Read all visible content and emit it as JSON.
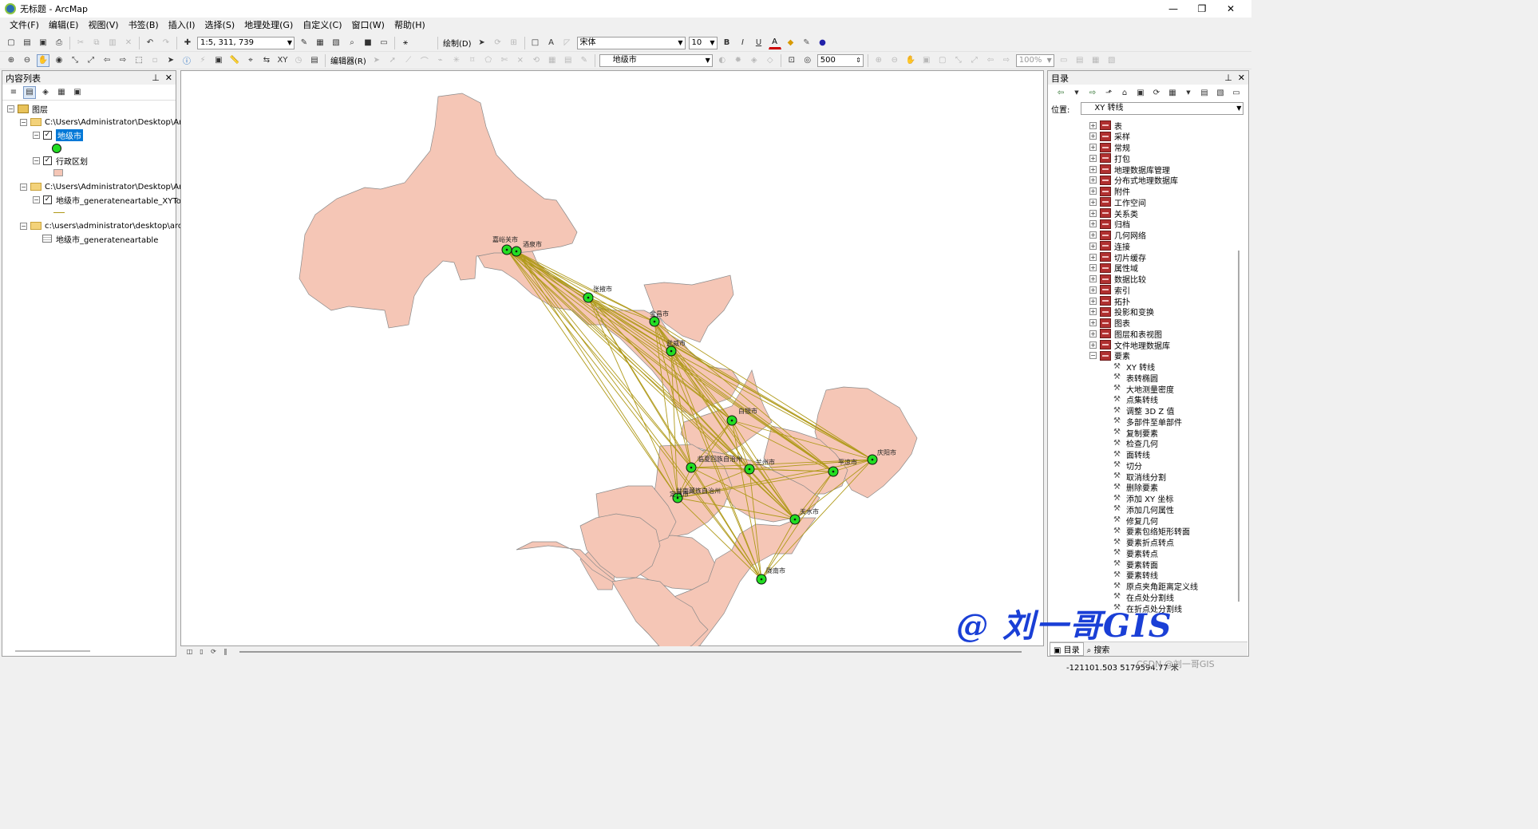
{
  "window": {
    "title": "无标题 - ArcMap",
    "min": "—",
    "max": "❐",
    "close": "✕"
  },
  "menu": [
    "文件(F)",
    "编辑(E)",
    "视图(V)",
    "书签(B)",
    "插入(I)",
    "选择(S)",
    "地理处理(G)",
    "自定义(C)",
    "窗口(W)",
    "帮助(H)"
  ],
  "toolbar1": {
    "scale": "1:5, 311, 739",
    "draw_label": "绘制(D)",
    "font": "宋体",
    "font_size": "10",
    "bold": "B",
    "italic": "I",
    "underline": "U",
    "font_color": "A"
  },
  "toolbar2": {
    "editor_label": "编辑器(R)",
    "layer_select": "地级市",
    "buffer_value": "500",
    "zoom_percent": "100%"
  },
  "toc": {
    "title": "内容列表",
    "pin": "ᵩ",
    "close": "✕",
    "root": "图层",
    "groups": [
      {
        "path": "C:\\Users\\Administrator\\Desktop\\Ar",
        "layers": [
          {
            "name": "地级市",
            "selected": true
          },
          {
            "name": "行政区划"
          }
        ]
      },
      {
        "path": "C:\\Users\\Administrator\\Desktop\\Ar",
        "layers": [
          {
            "name": "地级市_generateneartable_XYTo"
          }
        ]
      },
      {
        "path": "c:\\users\\administrator\\desktop\\arc",
        "layers": [
          {
            "name": "地级市_generateneartable"
          }
        ]
      }
    ]
  },
  "catalog": {
    "title": "目录",
    "location_label": "位置:",
    "location_value": "XY 转线",
    "toolsets": [
      "表",
      "采样",
      "常规",
      "打包",
      "地理数据库管理",
      "分布式地理数据库",
      "附件",
      "工作空间",
      "关系类",
      "归档",
      "几何网络",
      "连接",
      "切片缓存",
      "属性域",
      "数据比较",
      "索引",
      "拓扑",
      "投影和变换",
      "图表",
      "图层和表视图",
      "文件地理数据库",
      "要素"
    ],
    "tools": [
      "XY 转线",
      "表转椭圆",
      "大地测量密度",
      "点集转线",
      "调整 3D Z 值",
      "多部件至单部件",
      "复制要素",
      "检查几何",
      "面转线",
      "切分",
      "取消线分割",
      "删除要素",
      "添加 XY 坐标",
      "添加几何属性",
      "修复几何",
      "要素包络矩形转面",
      "要素折点转点",
      "要素转点",
      "要素转面",
      "要素转线",
      "原点夹角距离定义线",
      "在点处分割线",
      "在折点处分割线"
    ],
    "tabs": [
      "目录",
      "搜索"
    ]
  },
  "map": {
    "cities": [
      {
        "name": "嘉峪关市"
      },
      {
        "name": "酒泉市"
      },
      {
        "name": "张掖市"
      },
      {
        "name": "金昌市"
      },
      {
        "name": "武威市"
      },
      {
        "name": "白银市"
      },
      {
        "name": "临夏回族自治州"
      },
      {
        "name": "兰州市"
      },
      {
        "name": "定西市"
      },
      {
        "name": "甘南藏族自治州"
      },
      {
        "name": "平凉市"
      },
      {
        "name": "庆阳市"
      },
      {
        "name": "天水市"
      },
      {
        "name": "陇南市"
      }
    ]
  },
  "watermark": "@ 刘一哥GIS",
  "csdn": "CSDN @刘一哥GIS",
  "status": {
    "coords": "-121101.503  5179594.77 米"
  },
  "colors": {
    "poly": "#f5c6b6",
    "poly_stroke": "#8a8a8a",
    "line": "#b09a1a",
    "point": "#22dd22",
    "selection": "#0078d7"
  }
}
